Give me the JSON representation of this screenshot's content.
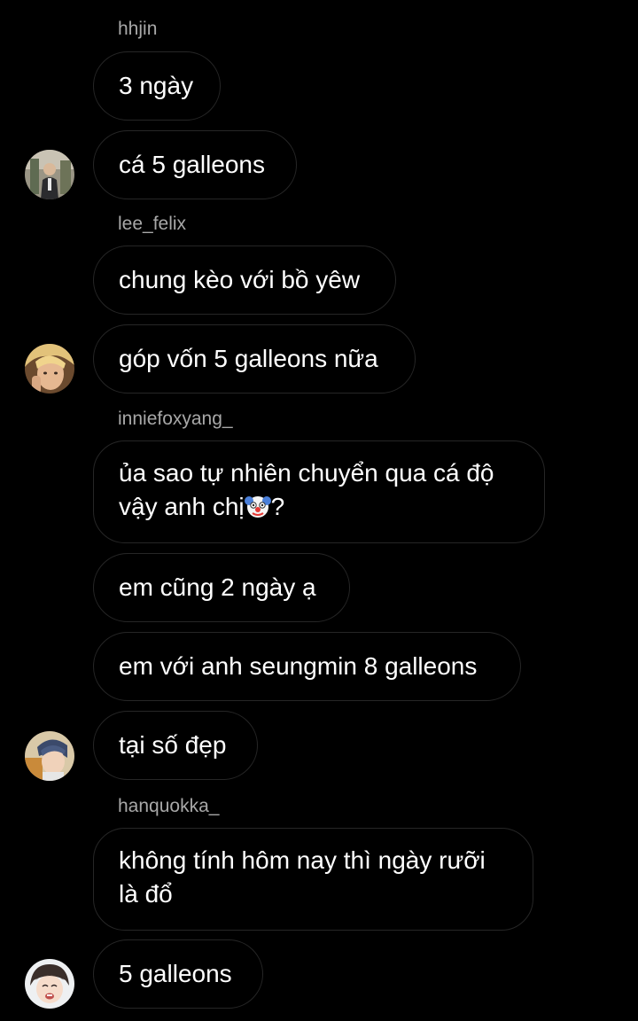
{
  "messages": [
    {
      "user": "hhjin",
      "texts": [
        "3 ngày",
        "cá 5 galleons"
      ]
    },
    {
      "user": "lee_felix",
      "texts": [
        "chung kèo với bồ yêw",
        "góp vốn 5 galleons nữa"
      ]
    },
    {
      "user": "inniefoxyang_",
      "texts": [
        "ủa sao tự nhiên chuyển qua cá độ",
        "vậy anh chị",
        "?",
        "em cũng 2 ngày ạ",
        "em với anh seungmin 8 galleons",
        "tại số đẹp"
      ]
    },
    {
      "user": "hanquokka_",
      "texts": [
        "không tính hôm nay thì ngày rưỡi",
        "là đổ",
        "5 galleons"
      ]
    }
  ],
  "emoji": {
    "clown": "clown-face-emoji"
  },
  "colors": {
    "background": "#000000",
    "bubble_border": "#262626",
    "username": "#a8a8a8",
    "text": "#ffffff"
  }
}
